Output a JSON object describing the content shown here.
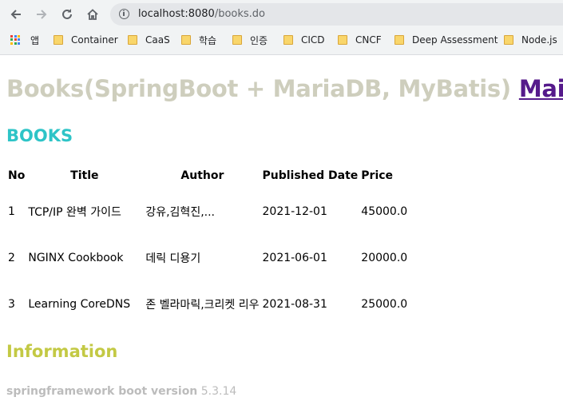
{
  "browser": {
    "url_host": "localhost:8080",
    "url_path": "/books.do",
    "bookmarks": [
      {
        "label": "앱",
        "icon": "apps-grid-icon"
      },
      {
        "label": "Container",
        "icon": "folder-icon"
      },
      {
        "label": "CaaS",
        "icon": "folder-icon"
      },
      {
        "label": "학습",
        "icon": "folder-icon"
      },
      {
        "label": "인증",
        "icon": "folder-icon"
      },
      {
        "label": "CICD",
        "icon": "folder-icon"
      },
      {
        "label": "CNCF",
        "icon": "folder-icon"
      },
      {
        "label": "Deep Assessment",
        "icon": "folder-icon"
      },
      {
        "label": "Node.js",
        "icon": "folder-icon"
      }
    ]
  },
  "page": {
    "title": "Books(SpringBoot + MariaDB, MyBatis)",
    "main_link": "Main",
    "books_heading": "BOOKS",
    "table": {
      "headers": [
        "No",
        "Title",
        "Author",
        "Published Date",
        "Price"
      ],
      "rows": [
        {
          "no": "1",
          "title": "TCP/IP 완벽 가이드",
          "author": "강유,김혁진,...",
          "date": "2021-12-01",
          "price": "45000.0"
        },
        {
          "no": "2",
          "title": "NGINX Cookbook",
          "author": "데릭 디용기",
          "date": "2021-06-01",
          "price": "20000.0"
        },
        {
          "no": "3",
          "title": "Learning CoreDNS",
          "author": "존 벨라마릭,크리켓 리우",
          "date": "2021-08-31",
          "price": "25000.0"
        }
      ]
    },
    "info_heading": "Information",
    "version_label": "springframework boot version",
    "version_value": "5.3.14"
  },
  "colors": {
    "title": "#cecebd",
    "books_heading": "#2ec4c7",
    "info_heading": "#c3c944",
    "link": "#551a8b"
  }
}
